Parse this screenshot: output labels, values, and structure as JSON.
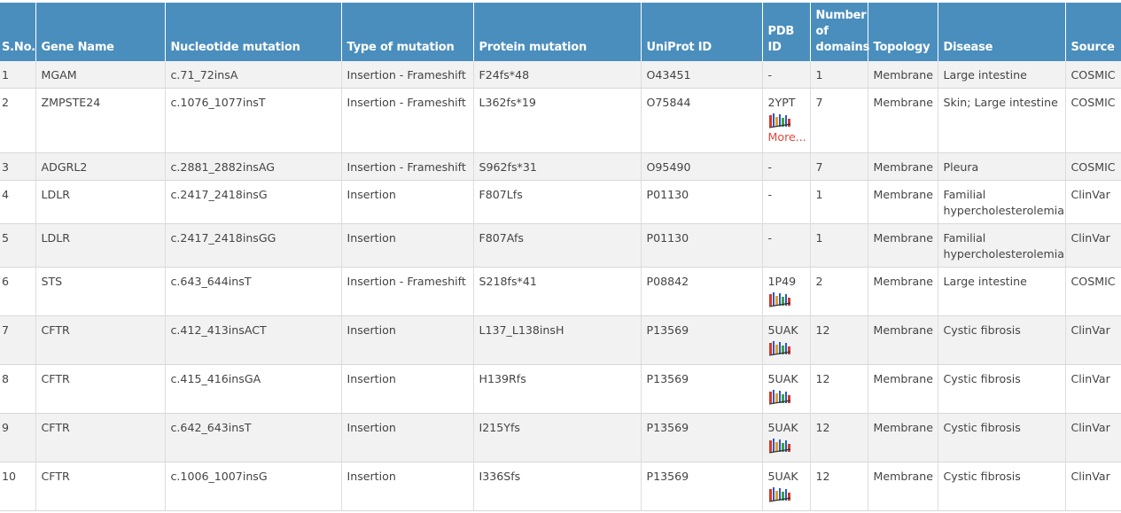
{
  "headers": {
    "sno": "S.No.",
    "gene": "Gene Name",
    "nucleotide": "Nucleotide mutation",
    "type": "Type of mutation",
    "protein": "Protein mutation",
    "uniprot": "UniProt ID",
    "pdb": "PDB ID",
    "domains_line1": "Number",
    "domains_line2": "of",
    "domains_line3": "domains",
    "topology": "Topology",
    "disease": "Disease",
    "source": "Source"
  },
  "rows": [
    {
      "sno": "1",
      "gene": "MGAM",
      "nucleotide": "c.71_72insA",
      "type": "Insertion - Frameshift",
      "protein": "F24fs*48",
      "uniprot": "O43451",
      "pdb": "-",
      "domains": "1",
      "topology": "Membrane",
      "disease": "Large intestine",
      "source": "COSMIC"
    },
    {
      "sno": "2",
      "gene": "ZMPSTE24",
      "nucleotide": "c.1076_1077insT",
      "type": "Insertion - Frameshift",
      "protein": "L362fs*19",
      "uniprot": "O75844",
      "pdb": "2YPT",
      "more": "More...",
      "domains": "7",
      "topology": "Membrane",
      "disease": "Skin; Large intestine",
      "source": "COSMIC"
    },
    {
      "sno": "3",
      "gene": "ADGRL2",
      "nucleotide": "c.2881_2882insAG",
      "type": "Insertion - Frameshift",
      "protein": "S962fs*31",
      "uniprot": "O95490",
      "pdb": "-",
      "domains": "7",
      "topology": "Membrane",
      "disease": "Pleura",
      "source": "COSMIC"
    },
    {
      "sno": "4",
      "gene": "LDLR",
      "nucleotide": "c.2417_2418insG",
      "type": "Insertion",
      "protein": "F807Lfs",
      "uniprot": "P01130",
      "pdb": "-",
      "domains": "1",
      "topology": "Membrane",
      "disease": "Familial hypercholesterolemia",
      "source": "ClinVar"
    },
    {
      "sno": "5",
      "gene": "LDLR",
      "nucleotide": "c.2417_2418insGG",
      "type": "Insertion",
      "protein": "F807Afs",
      "uniprot": "P01130",
      "pdb": "-",
      "domains": "1",
      "topology": "Membrane",
      "disease": "Familial hypercholesterolemia",
      "source": "ClinVar"
    },
    {
      "sno": "6",
      "gene": "STS",
      "nucleotide": "c.643_644insT",
      "type": "Insertion - Frameshift",
      "protein": "S218fs*41",
      "uniprot": "P08842",
      "pdb": "1P49",
      "domains": "2",
      "topology": "Membrane",
      "disease": "Large intestine",
      "source": "COSMIC"
    },
    {
      "sno": "7",
      "gene": "CFTR",
      "nucleotide": "c.412_413insACT",
      "type": "Insertion",
      "protein": "L137_L138insH",
      "uniprot": "P13569",
      "pdb": "5UAK",
      "domains": "12",
      "topology": "Membrane",
      "disease": "Cystic fibrosis",
      "source": "ClinVar"
    },
    {
      "sno": "8",
      "gene": "CFTR",
      "nucleotide": "c.415_416insGA",
      "type": "Insertion",
      "protein": "H139Rfs",
      "uniprot": "P13569",
      "pdb": "5UAK",
      "domains": "12",
      "topology": "Membrane",
      "disease": "Cystic fibrosis",
      "source": "ClinVar"
    },
    {
      "sno": "9",
      "gene": "CFTR",
      "nucleotide": "c.642_643insT",
      "type": "Insertion",
      "protein": "I215Yfs",
      "uniprot": "P13569",
      "pdb": "5UAK",
      "domains": "12",
      "topology": "Membrane",
      "disease": "Cystic fibrosis",
      "source": "ClinVar"
    },
    {
      "sno": "10",
      "gene": "CFTR",
      "nucleotide": "c.1006_1007insG",
      "type": "Insertion",
      "protein": "I336Sfs",
      "uniprot": "P13569",
      "pdb": "5UAK",
      "domains": "12",
      "topology": "Membrane",
      "disease": "Cystic fibrosis",
      "source": "ClinVar"
    }
  ],
  "icons": {
    "jmol": "jmol-structure-icon"
  },
  "colors": {
    "header_bg": "#4a8ebd",
    "link": "#e0483c",
    "row_alt": "#f2f2f2"
  }
}
